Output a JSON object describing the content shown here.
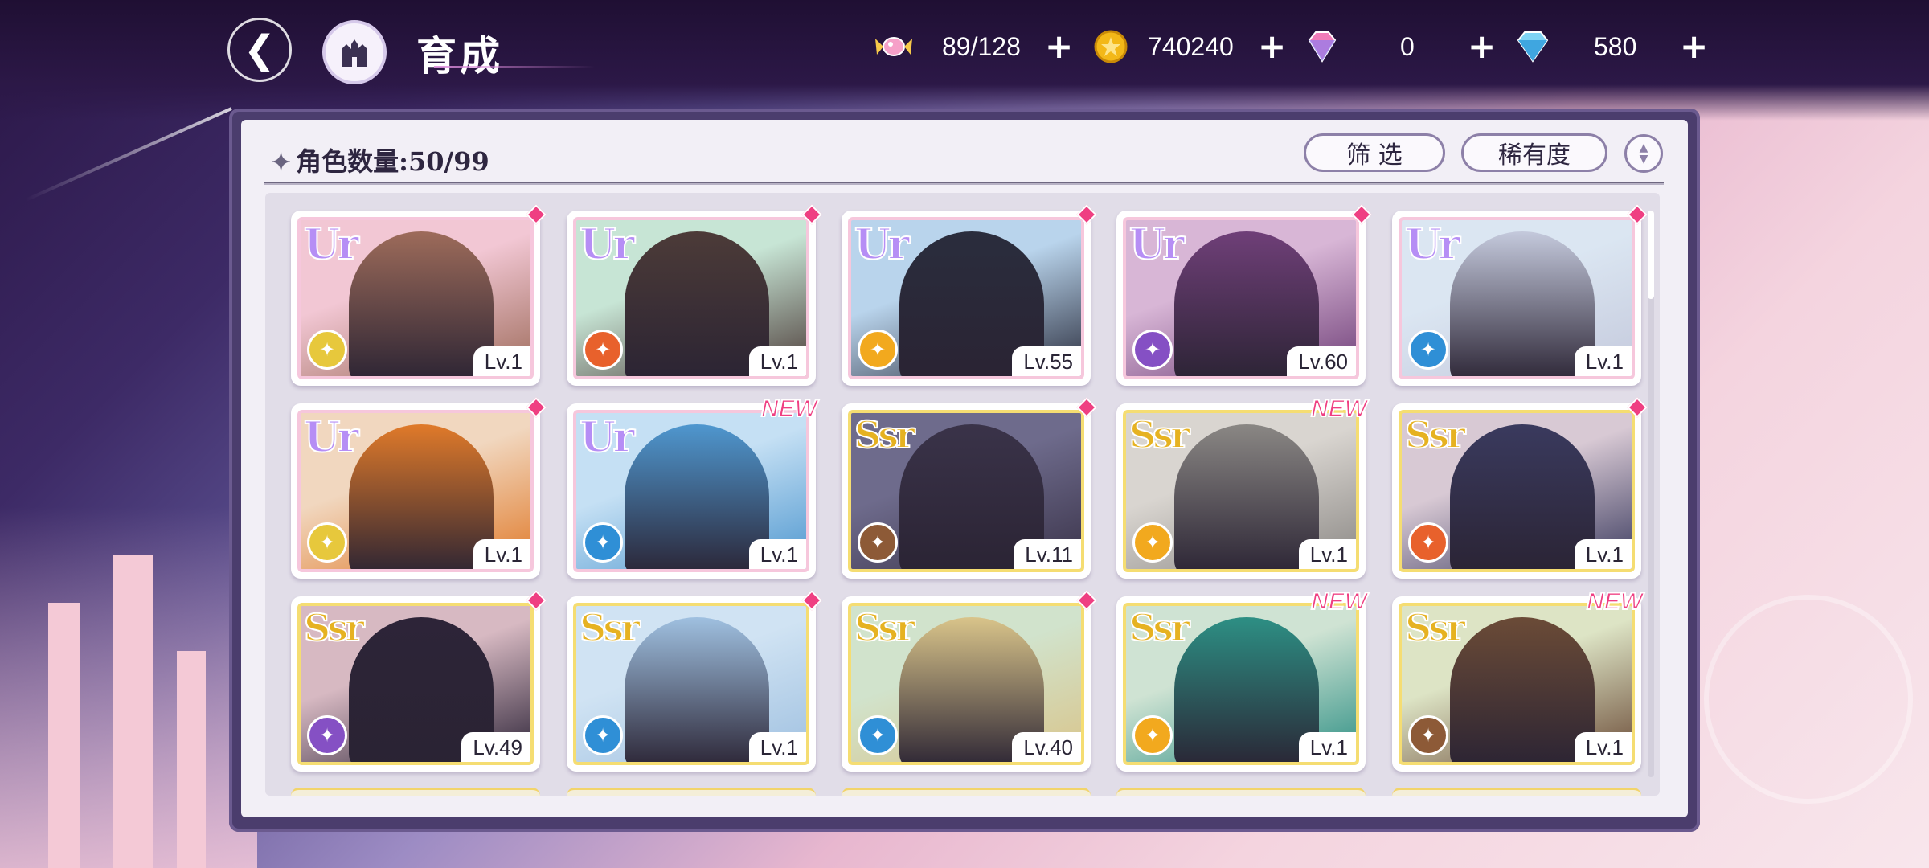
{
  "header": {
    "title": "育成",
    "resources": [
      {
        "icon": "candy-icon",
        "value": "89/128"
      },
      {
        "icon": "gold-coin-icon",
        "value": "740240"
      },
      {
        "icon": "pink-gem-icon",
        "value": "0"
      },
      {
        "icon": "blue-diamond-icon",
        "value": "580"
      }
    ],
    "plus_label": "+"
  },
  "panel": {
    "count_label": "角色数量:",
    "count_value": "50/99",
    "filter_label": "筛 选",
    "rarity_label": "稀有度"
  },
  "cards": [
    {
      "rarity": "UR",
      "level": "Lv.1",
      "class_color": "#e7c83c",
      "new": false,
      "bg": [
        "#f2c7d4",
        "#9d6b5a"
      ]
    },
    {
      "rarity": "UR",
      "level": "Lv.1",
      "class_color": "#e8612c",
      "new": false,
      "bg": [
        "#c7e5d5",
        "#4c3b38"
      ]
    },
    {
      "rarity": "UR",
      "level": "Lv.55",
      "class_color": "#f2a91e",
      "new": false,
      "bg": [
        "#b9d4ec",
        "#2a2d3d"
      ]
    },
    {
      "rarity": "UR",
      "level": "Lv.60",
      "class_color": "#8550c4",
      "new": false,
      "bg": [
        "#d8b6d6",
        "#6f3f78"
      ]
    },
    {
      "rarity": "UR",
      "level": "Lv.1",
      "class_color": "#2f8fd6",
      "new": false,
      "bg": [
        "#dbe6f2",
        "#c4c9dc"
      ]
    },
    {
      "rarity": "UR",
      "level": "Lv.1",
      "class_color": "#e7c83c",
      "new": false,
      "bg": [
        "#f1d7bf",
        "#e07a2a"
      ]
    },
    {
      "rarity": "UR",
      "level": "Lv.1",
      "class_color": "#2f8fd6",
      "new": true,
      "bg": [
        "#c5e0f4",
        "#4f97cf"
      ]
    },
    {
      "rarity": "SSR",
      "level": "Lv.11",
      "class_color": "#8d5a37",
      "new": false,
      "bg": [
        "#6e6b8c",
        "#3a3349"
      ]
    },
    {
      "rarity": "SSR",
      "level": "Lv.1",
      "class_color": "#f2a91e",
      "new": true,
      "bg": [
        "#d9d5d0",
        "#8a8784"
      ]
    },
    {
      "rarity": "SSR",
      "level": "Lv.1",
      "class_color": "#e8612c",
      "new": false,
      "bg": [
        "#d8c9d4",
        "#3a3a5e"
      ]
    },
    {
      "rarity": "SSR",
      "level": "Lv.49",
      "class_color": "#8550c4",
      "new": false,
      "bg": [
        "#d7b9c2",
        "#2d2438"
      ]
    },
    {
      "rarity": "SSR",
      "level": "Lv.1",
      "class_color": "#2f8fd6",
      "new": false,
      "bg": [
        "#d0e3f3",
        "#9fc0e0"
      ]
    },
    {
      "rarity": "SSR",
      "level": "Lv.40",
      "class_color": "#2f8fd6",
      "new": false,
      "bg": [
        "#d1e3cc",
        "#d9c48a"
      ]
    },
    {
      "rarity": "SSR",
      "level": "Lv.1",
      "class_color": "#f2a91e",
      "new": true,
      "bg": [
        "#cfe3d3",
        "#2d8f84"
      ]
    },
    {
      "rarity": "SSR",
      "level": "Lv.1",
      "class_color": "#8d5a37",
      "new": true,
      "bg": [
        "#dde4c5",
        "#6b4b37"
      ]
    }
  ],
  "new_label": "NEW"
}
